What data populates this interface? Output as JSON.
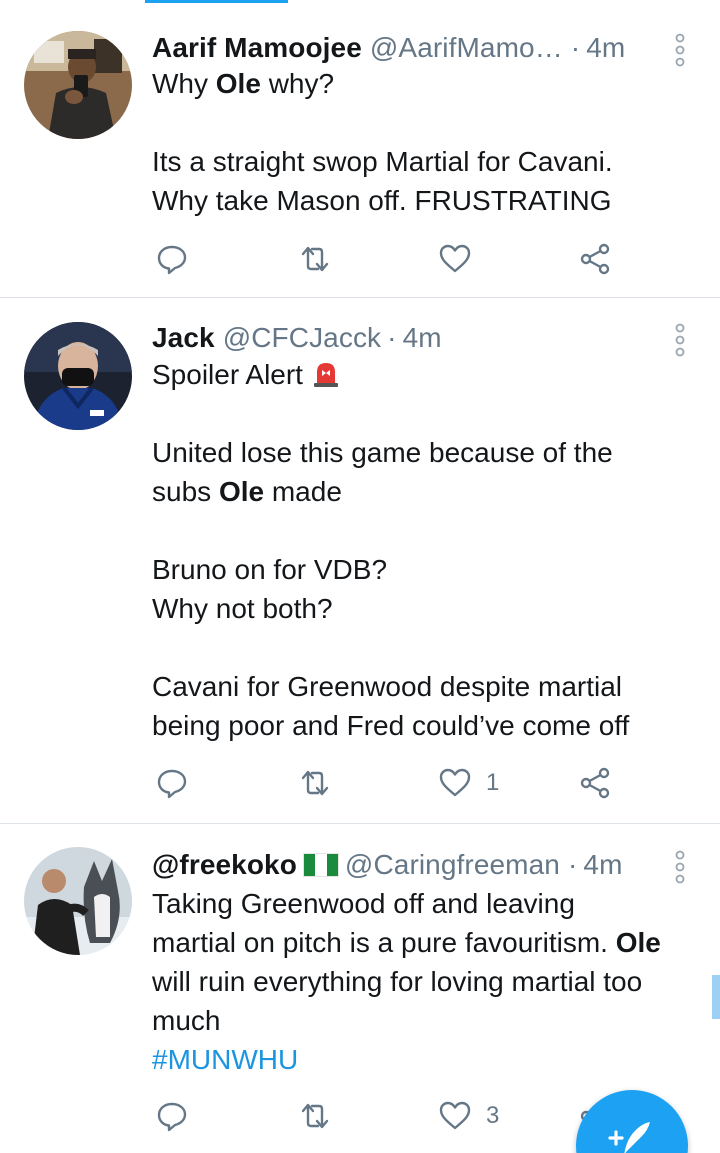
{
  "colors": {
    "accent": "#1da1f2",
    "text": "#14171a",
    "secondary": "#657786",
    "divider": "#dde3e8",
    "link": "#1b95e0"
  },
  "tweets": [
    {
      "name": "Aarif Mamoojee",
      "handle": "@AarifMamo…",
      "separator": "·",
      "time": "4m",
      "lines": [
        [
          {
            "t": "Why "
          },
          {
            "t": "Ole",
            "b": true
          },
          {
            "t": " why?"
          }
        ],
        [],
        [
          {
            "t": "Its a straight swop Martial for Cavani."
          }
        ],
        [
          {
            "t": "Why take Mason off. FRUSTRATING"
          }
        ]
      ],
      "likes": ""
    },
    {
      "name": "Jack",
      "handle": "@CFCJacck",
      "separator": "·",
      "time": "4m",
      "lines": [
        [
          {
            "t": "Spoiler Alert "
          },
          {
            "emoji": "siren"
          }
        ],
        [],
        [
          {
            "t": "United lose this game because of the"
          }
        ],
        [
          {
            "t": "subs "
          },
          {
            "t": "Ole",
            "b": true
          },
          {
            "t": " made"
          }
        ],
        [],
        [
          {
            "t": "Bruno on for VDB?"
          }
        ],
        [
          {
            "t": "Why not both?"
          }
        ],
        [],
        [
          {
            "t": "Cavani for Greenwood despite martial"
          }
        ],
        [
          {
            "t": "being poor and Fred could’ve come off"
          }
        ]
      ],
      "likes": "1"
    },
    {
      "name": "@freekoko",
      "name_flag": "nigeria-flag",
      "handle": "@Caringfreeman",
      "separator": "·",
      "time": "4m",
      "lines": [
        [
          {
            "t": "Taking Greenwood off and leaving"
          }
        ],
        [
          {
            "t": "martial on pitch is a pure favouritism. "
          },
          {
            "t": "Ole",
            "b": true
          }
        ],
        [
          {
            "t": "will ruin everything for loving martial too"
          }
        ],
        [
          {
            "t": "much"
          }
        ],
        [
          {
            "t": "#MUNWHU",
            "h": true
          }
        ]
      ],
      "likes": "3"
    }
  ],
  "icons": {
    "reply": "reply-icon",
    "retweet": "retweet-icon",
    "like": "heart-icon",
    "share": "share-icon",
    "menu": "more-vertical-icon",
    "compose": "compose-tweet-icon"
  }
}
